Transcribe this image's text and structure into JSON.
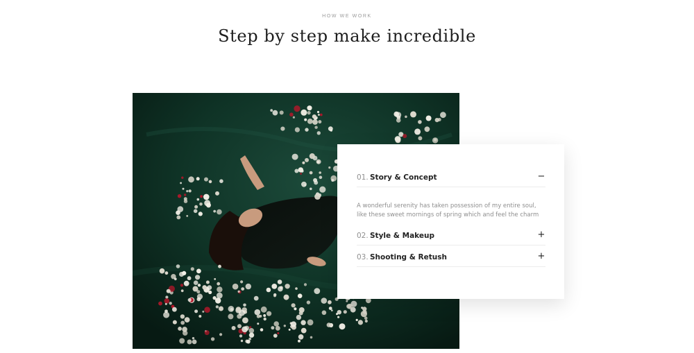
{
  "section": {
    "eyebrow": "HOW WE WORK",
    "heading": "Step by step make incredible"
  },
  "photo": {
    "alt_icon": "photo-woman-floating-among-flowers"
  },
  "accordion": {
    "items": [
      {
        "number": "01.",
        "title": "Story & Concept",
        "toggle": "−",
        "expanded": true,
        "body": "A wonderful serenity has taken possession of my entire soul, like these sweet mornings of spring which and feel the charm"
      },
      {
        "number": "02.",
        "title": "Style & Makeup",
        "toggle": "+",
        "expanded": false
      },
      {
        "number": "03.",
        "title": "Shooting & Retush",
        "toggle": "+",
        "expanded": false
      }
    ]
  },
  "colors": {
    "background": "#ffffff",
    "heading": "#1d1d1d",
    "muted": "#8e8e8e",
    "photo_base": "#0d2a1f"
  }
}
